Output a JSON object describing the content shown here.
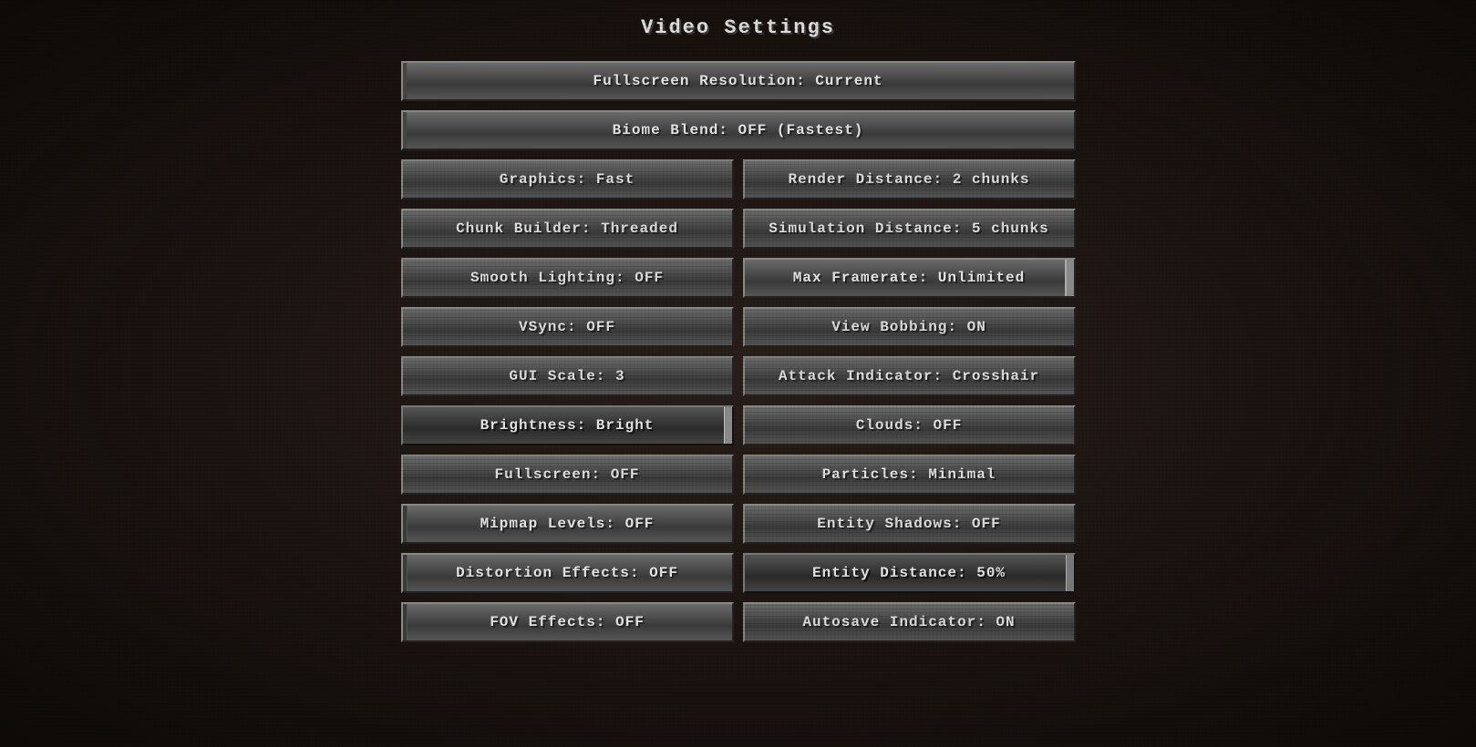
{
  "title": "Video Settings",
  "buttons": {
    "fullscreen_resolution": "Fullscreen Resolution: Current",
    "biome_blend": "Biome Blend: OFF (Fastest)",
    "graphics": "Graphics: Fast",
    "render_distance": "Render Distance: 2 chunks",
    "chunk_builder": "Chunk Builder: Threaded",
    "simulation_distance": "Simulation Distance: 5 chunks",
    "smooth_lighting": "Smooth Lighting: OFF",
    "max_framerate": "Max Framerate: Unlimited",
    "vsync": "VSync: OFF",
    "view_bobbing": "View Bobbing: ON",
    "gui_scale": "GUI Scale: 3",
    "attack_indicator": "Attack Indicator: Crosshair",
    "brightness": "Brightness: Bright",
    "clouds": "Clouds: OFF",
    "fullscreen": "Fullscreen: OFF",
    "particles": "Particles: Minimal",
    "mipmap_levels": "Mipmap Levels: OFF",
    "entity_shadows": "Entity Shadows: OFF",
    "distortion_effects": "Distortion Effects: OFF",
    "entity_distance": "Entity Distance: 50%",
    "fov_effects": "FOV Effects: OFF",
    "autosave_indicator": "Autosave Indicator: ON"
  }
}
